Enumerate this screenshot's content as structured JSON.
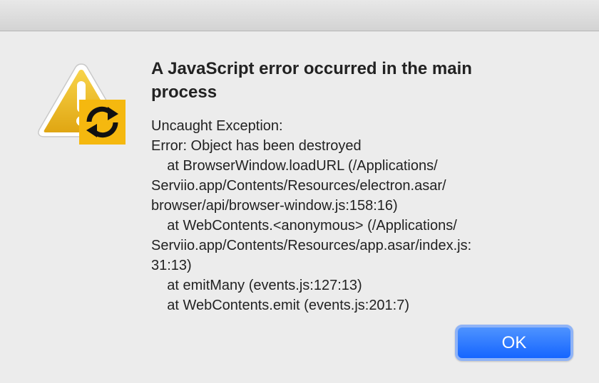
{
  "dialog": {
    "heading": "A JavaScript error occurred in the main process",
    "message": "Uncaught Exception:\nError: Object has been destroyed\n    at BrowserWindow.loadURL (/Applications/\nServiio.app/Contents/Resources/electron.asar/\nbrowser/api/browser-window.js:158:16)\n    at WebContents.<anonymous> (/Applications/\nServiio.app/Contents/Resources/app.asar/index.js:\n31:13)\n    at emitMany (events.js:127:13)\n    at WebContents.emit (events.js:201:7)",
    "ok_label": "OK",
    "icon": "warning-icon",
    "badge_icon": "app-sync-icon"
  },
  "colors": {
    "warning_yellow": "#f1be1d",
    "badge_yellow": "#f5b80f",
    "button_blue": "#2d7bff"
  }
}
